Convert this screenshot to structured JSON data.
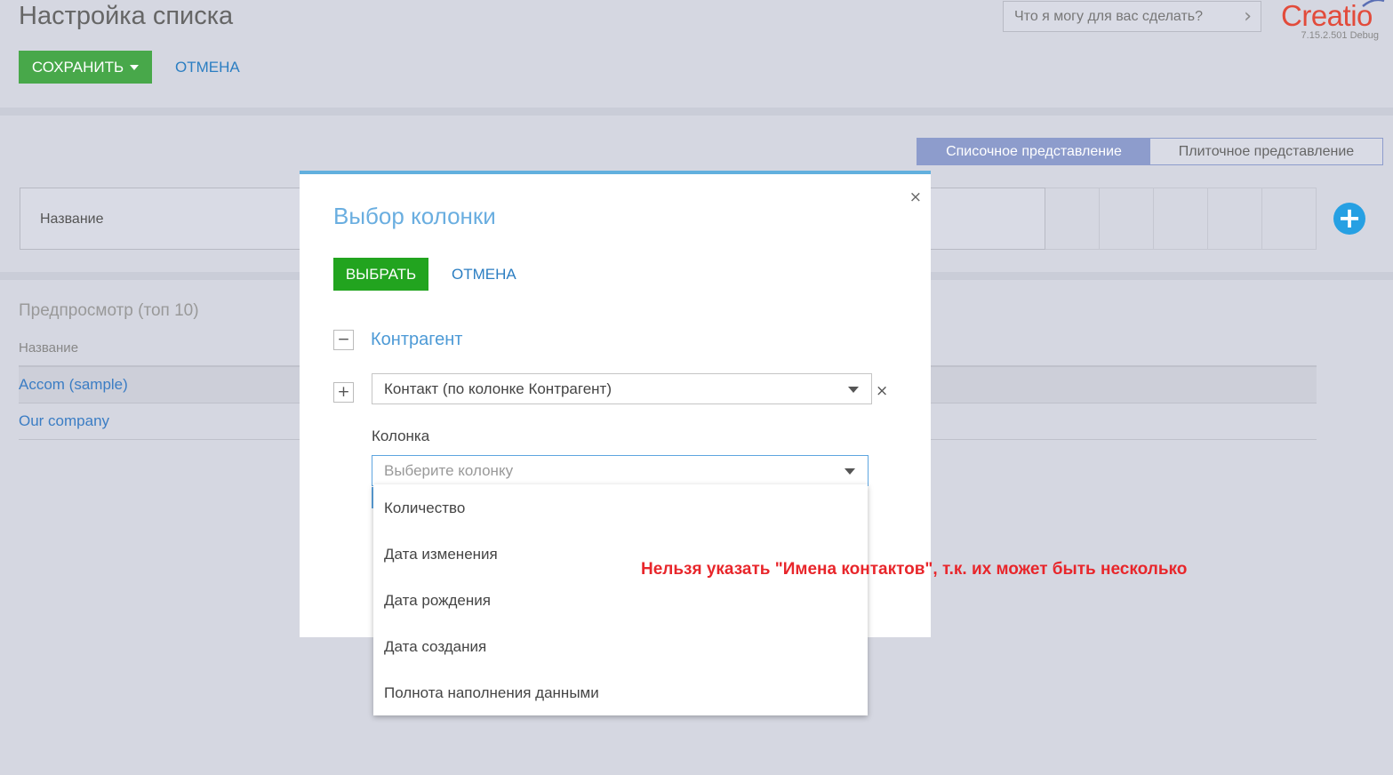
{
  "header": {
    "title": "Настройка списка",
    "save_label": "СОХРАНИТЬ",
    "cancel_label": "ОТМЕНА",
    "search_placeholder": "Что я могу для вас сделать?",
    "logo_text": "Creatio",
    "version": "7.15.2.501 Debug"
  },
  "view_toggle": {
    "list_label": "Списочное представление",
    "tile_label": "Плиточное представление",
    "active": "list"
  },
  "columns": {
    "first_column": "Название"
  },
  "preview": {
    "title": "Предпросмотр (топ 10)",
    "column_header": "Название",
    "rows": [
      "Accom (sample)",
      "Our company"
    ]
  },
  "modal": {
    "title": "Выбор колонки",
    "choose_label": "ВЫБРАТЬ",
    "cancel_label": "ОТМЕНА",
    "group_title": "Контрагент",
    "collapse_symbol": "−",
    "expand_symbol": "+",
    "path_select_value": "Контакт (по колонке Контрагент)",
    "column_label": "Колонка",
    "column_placeholder": "Выберите колонку",
    "close_symbol": "×",
    "remove_symbol": "×"
  },
  "dropdown": {
    "options": [
      "Количество",
      "Дата изменения",
      "Дата рождения",
      "Дата создания",
      "Полнота наполнения данными"
    ]
  },
  "annotation": {
    "text": "Нельзя указать \"Имена контактов\", т.к. их может быть несколько",
    "color": "#e8262b"
  },
  "colors": {
    "save_green": "#48a84a",
    "choose_green": "#22a41f",
    "link_blue": "#2b7ec2",
    "toggle_active": "#8d9ccc",
    "add_button": "#26a0e3",
    "logo_red": "#e24b3b"
  }
}
